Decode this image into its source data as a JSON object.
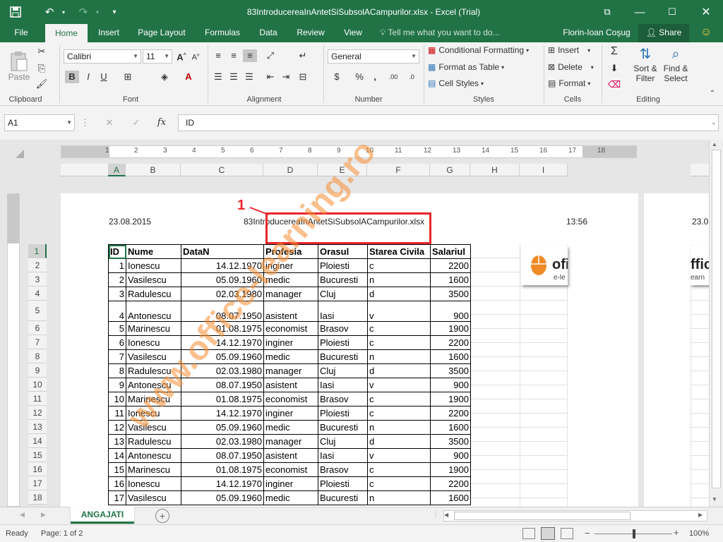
{
  "titlebar": {
    "title": "83IntroducereaInAntetSiSubsolACampurilor.xlsx - Excel (Trial)"
  },
  "tabs": [
    "File",
    "Home",
    "Insert",
    "Page Layout",
    "Formulas",
    "Data",
    "Review",
    "View"
  ],
  "tell_me": "Tell me what you want to do...",
  "user": "Florin-Ioan Coşug",
  "share": "Share",
  "ribbon": {
    "paste": "Paste",
    "font_name": "Calibri",
    "font_size": "11",
    "number_format": "General",
    "conditional_formatting": "Conditional Formatting",
    "format_as_table": "Format as Table",
    "cell_styles": "Cell Styles",
    "insert": "Insert",
    "delete": "Delete",
    "format": "Format",
    "sort_filter_1": "Sort &",
    "sort_filter_2": "Filter",
    "find_select_1": "Find &",
    "find_select_2": "Select",
    "groups": {
      "clipboard": "Clipboard",
      "font": "Font",
      "alignment": "Alignment",
      "number": "Number",
      "styles": "Styles",
      "cells": "Cells",
      "editing": "Editing"
    }
  },
  "formula_bar": {
    "name_box": "A1",
    "fx": "fx",
    "content": "ID"
  },
  "ruler_numbers": [
    "1",
    "2",
    "3",
    "4",
    "5",
    "6",
    "7",
    "8",
    "9",
    "10",
    "11",
    "12",
    "13",
    "14",
    "15",
    "16",
    "17",
    "18"
  ],
  "columns": [
    "A",
    "B",
    "C",
    "D",
    "E",
    "F",
    "G",
    "H",
    "I"
  ],
  "page": {
    "header_left": "23.08.2015",
    "header_center": "83IntroducereaInAntetSiSubsolACampurilor.xlsx",
    "header_right": "13:56",
    "next_page_header": "23.0",
    "annotation": "1",
    "logo_text": "ofi",
    "logo_sub": "e-le",
    "logo2_text": "ffic",
    "logo2_sub": "earn",
    "watermark": "www.office-learning.ro"
  },
  "table": {
    "headers": [
      "ID",
      "Nume",
      "DataN",
      "Profesia",
      "Orasul",
      "Starea Civila",
      "Salariul"
    ],
    "rows": [
      [
        "1",
        "Ionescu",
        "14.12.1970",
        "inginer",
        "Ploiesti",
        "c",
        "2200"
      ],
      [
        "2",
        "Vasilescu",
        "05.09.1960",
        "medic",
        "Bucuresti",
        "n",
        "1600"
      ],
      [
        "3",
        "Radulescu",
        "02.03.1980",
        "manager",
        "Cluj",
        "d",
        "3500"
      ],
      [
        "4",
        "Antonescu",
        "08.07.1950",
        "asistent",
        "Iasi",
        "v",
        "900"
      ],
      [
        "5",
        "Marinescu",
        "01.08.1975",
        "economist",
        "Brasov",
        "c",
        "1900"
      ],
      [
        "6",
        "Ionescu",
        "14.12.1970",
        "inginer",
        "Ploiesti",
        "c",
        "2200"
      ],
      [
        "7",
        "Vasilescu",
        "05.09.1960",
        "medic",
        "Bucuresti",
        "n",
        "1600"
      ],
      [
        "8",
        "Radulescu",
        "02.03.1980",
        "manager",
        "Cluj",
        "d",
        "3500"
      ],
      [
        "9",
        "Antonescu",
        "08.07.1950",
        "asistent",
        "Iasi",
        "v",
        "900"
      ],
      [
        "10",
        "Marinescu",
        "01.08.1975",
        "economist",
        "Brasov",
        "c",
        "1900"
      ],
      [
        "11",
        "Ionescu",
        "14.12.1970",
        "inginer",
        "Ploiesti",
        "c",
        "2200"
      ],
      [
        "12",
        "Vasilescu",
        "05.09.1960",
        "medic",
        "Bucuresti",
        "n",
        "1600"
      ],
      [
        "13",
        "Radulescu",
        "02.03.1980",
        "manager",
        "Cluj",
        "d",
        "3500"
      ],
      [
        "14",
        "Antonescu",
        "08.07.1950",
        "asistent",
        "Iasi",
        "v",
        "900"
      ],
      [
        "15",
        "Marinescu",
        "01.08.1975",
        "economist",
        "Brasov",
        "c",
        "1900"
      ],
      [
        "16",
        "Ionescu",
        "14.12.1970",
        "inginer",
        "Ploiesti",
        "c",
        "2200"
      ],
      [
        "17",
        "Vasilescu",
        "05.09.1960",
        "medic",
        "Bucuresti",
        "n",
        "1600"
      ]
    ]
  },
  "row_numbers": [
    "1",
    "2",
    "3",
    "4",
    "5",
    "6",
    "7",
    "8",
    "9",
    "10",
    "11",
    "12",
    "13",
    "14",
    "15",
    "16",
    "17",
    "18"
  ],
  "sheet_tab": "ANGAJATI",
  "status": {
    "ready": "Ready",
    "page": "Page: 1 of 2",
    "zoom": "100%"
  },
  "colors": {
    "brand": "#217346",
    "annotation": "#e8262c",
    "watermark": "#f58c32"
  }
}
